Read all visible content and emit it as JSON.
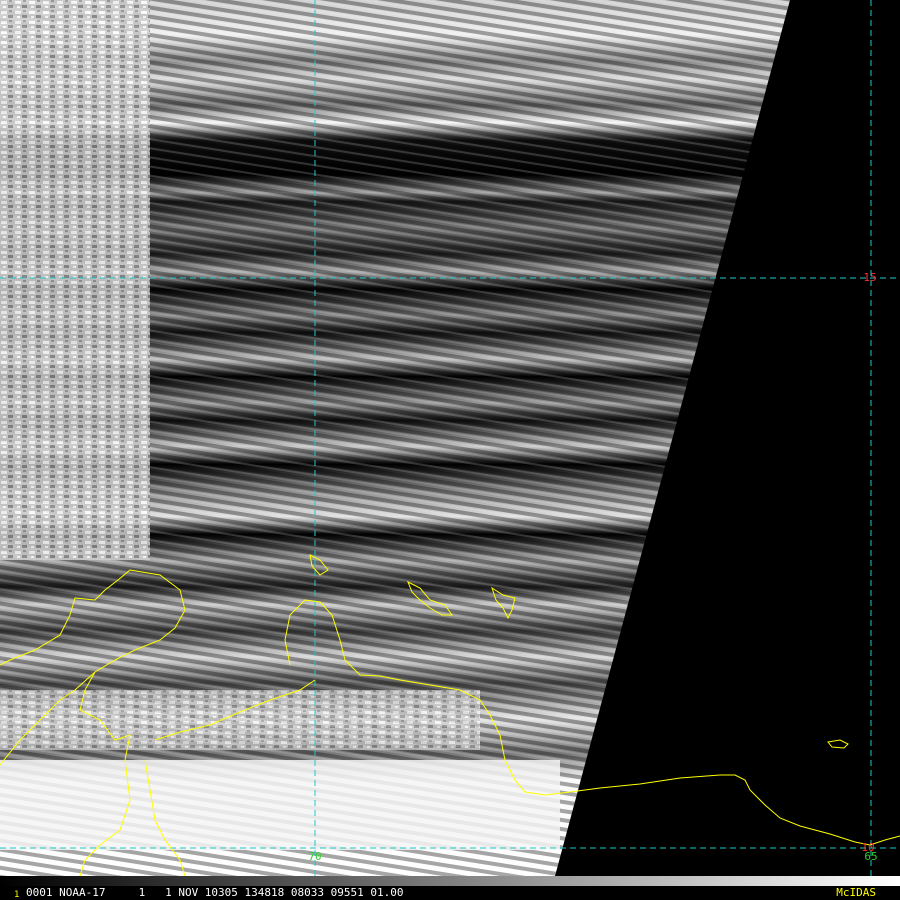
{
  "map": {
    "grid_color": "#1ec8c8",
    "coast_color": "#ffff00",
    "lat_label_color": "#ff3030",
    "lon_label_color": "#30d030",
    "graticule": {
      "latitudes": [
        {
          "label": "15"
        },
        {
          "label": "10"
        }
      ],
      "longitudes": [
        {
          "label": "70"
        },
        {
          "label": "65"
        }
      ]
    }
  },
  "status_bar": {
    "frame": "1",
    "text": "0001 NOAA-17     1   1 NOV 10305 134818 08033 09551 01.00",
    "brand": "McIDAS"
  }
}
